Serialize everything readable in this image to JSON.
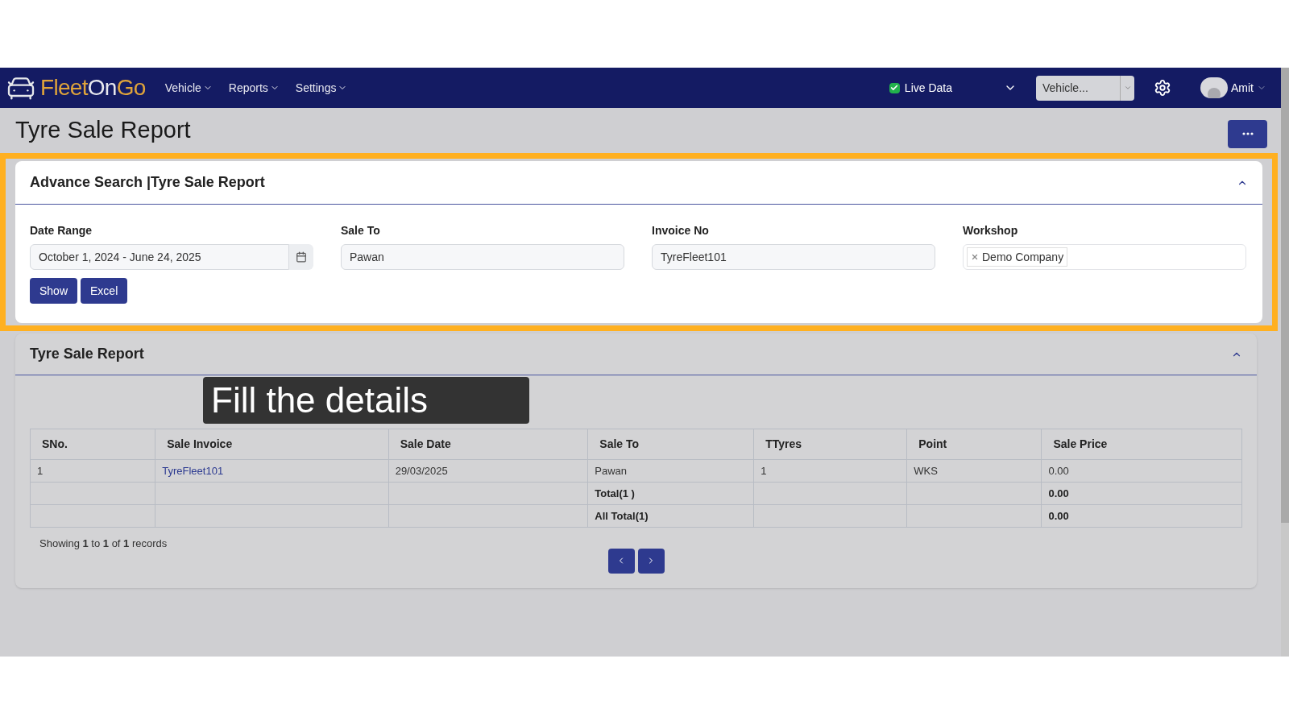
{
  "navbar": {
    "logo": [
      {
        "text": "Fleet",
        "kind": "accent"
      },
      {
        "text": "On",
        "kind": "plain"
      },
      {
        "text": "Go",
        "kind": "accent"
      }
    ],
    "menu": [
      {
        "label": "Vehicle"
      },
      {
        "label": "Reports"
      },
      {
        "label": "Settings"
      }
    ],
    "live_data": {
      "label": "Live Data",
      "checked": true
    },
    "vehicle_select": {
      "value": "Vehicle..."
    },
    "user": {
      "name": "Amit"
    }
  },
  "page_title": "Tyre Sale Report",
  "search_panel": {
    "title": "Advance Search |Tyre Sale Report",
    "fields": [
      {
        "label": "Date Range",
        "kind": "date",
        "value": "October 1, 2024 - June 24, 2025"
      },
      {
        "label": "Sale To",
        "kind": "text",
        "value": "Pawan"
      },
      {
        "label": "Invoice No",
        "kind": "text",
        "value": "TyreFleet101"
      },
      {
        "label": "Workshop",
        "kind": "tags",
        "tags": [
          "Demo Company"
        ]
      }
    ],
    "buttons": [
      "Show",
      "Excel"
    ]
  },
  "report_panel": {
    "title": "Tyre Sale Report",
    "columns": [
      "SNo.",
      "Sale Invoice",
      "Sale Date",
      "Sale To",
      "TTyres",
      "Point",
      "Sale Price"
    ],
    "rows": [
      {
        "kind": "data",
        "sno": "1",
        "invoice": "TyreFleet101",
        "date": "29/03/2025",
        "sale_to": "Pawan",
        "tyres": "1",
        "point": "WKS",
        "price": "0.00"
      },
      {
        "kind": "total",
        "label": "Total(1 )",
        "price": "0.00"
      },
      {
        "kind": "total",
        "label": "All Total(1)",
        "price": "0.00"
      }
    ],
    "summary": "Showing **1** to **1** of **1** records"
  },
  "caption": "Fill the details"
}
